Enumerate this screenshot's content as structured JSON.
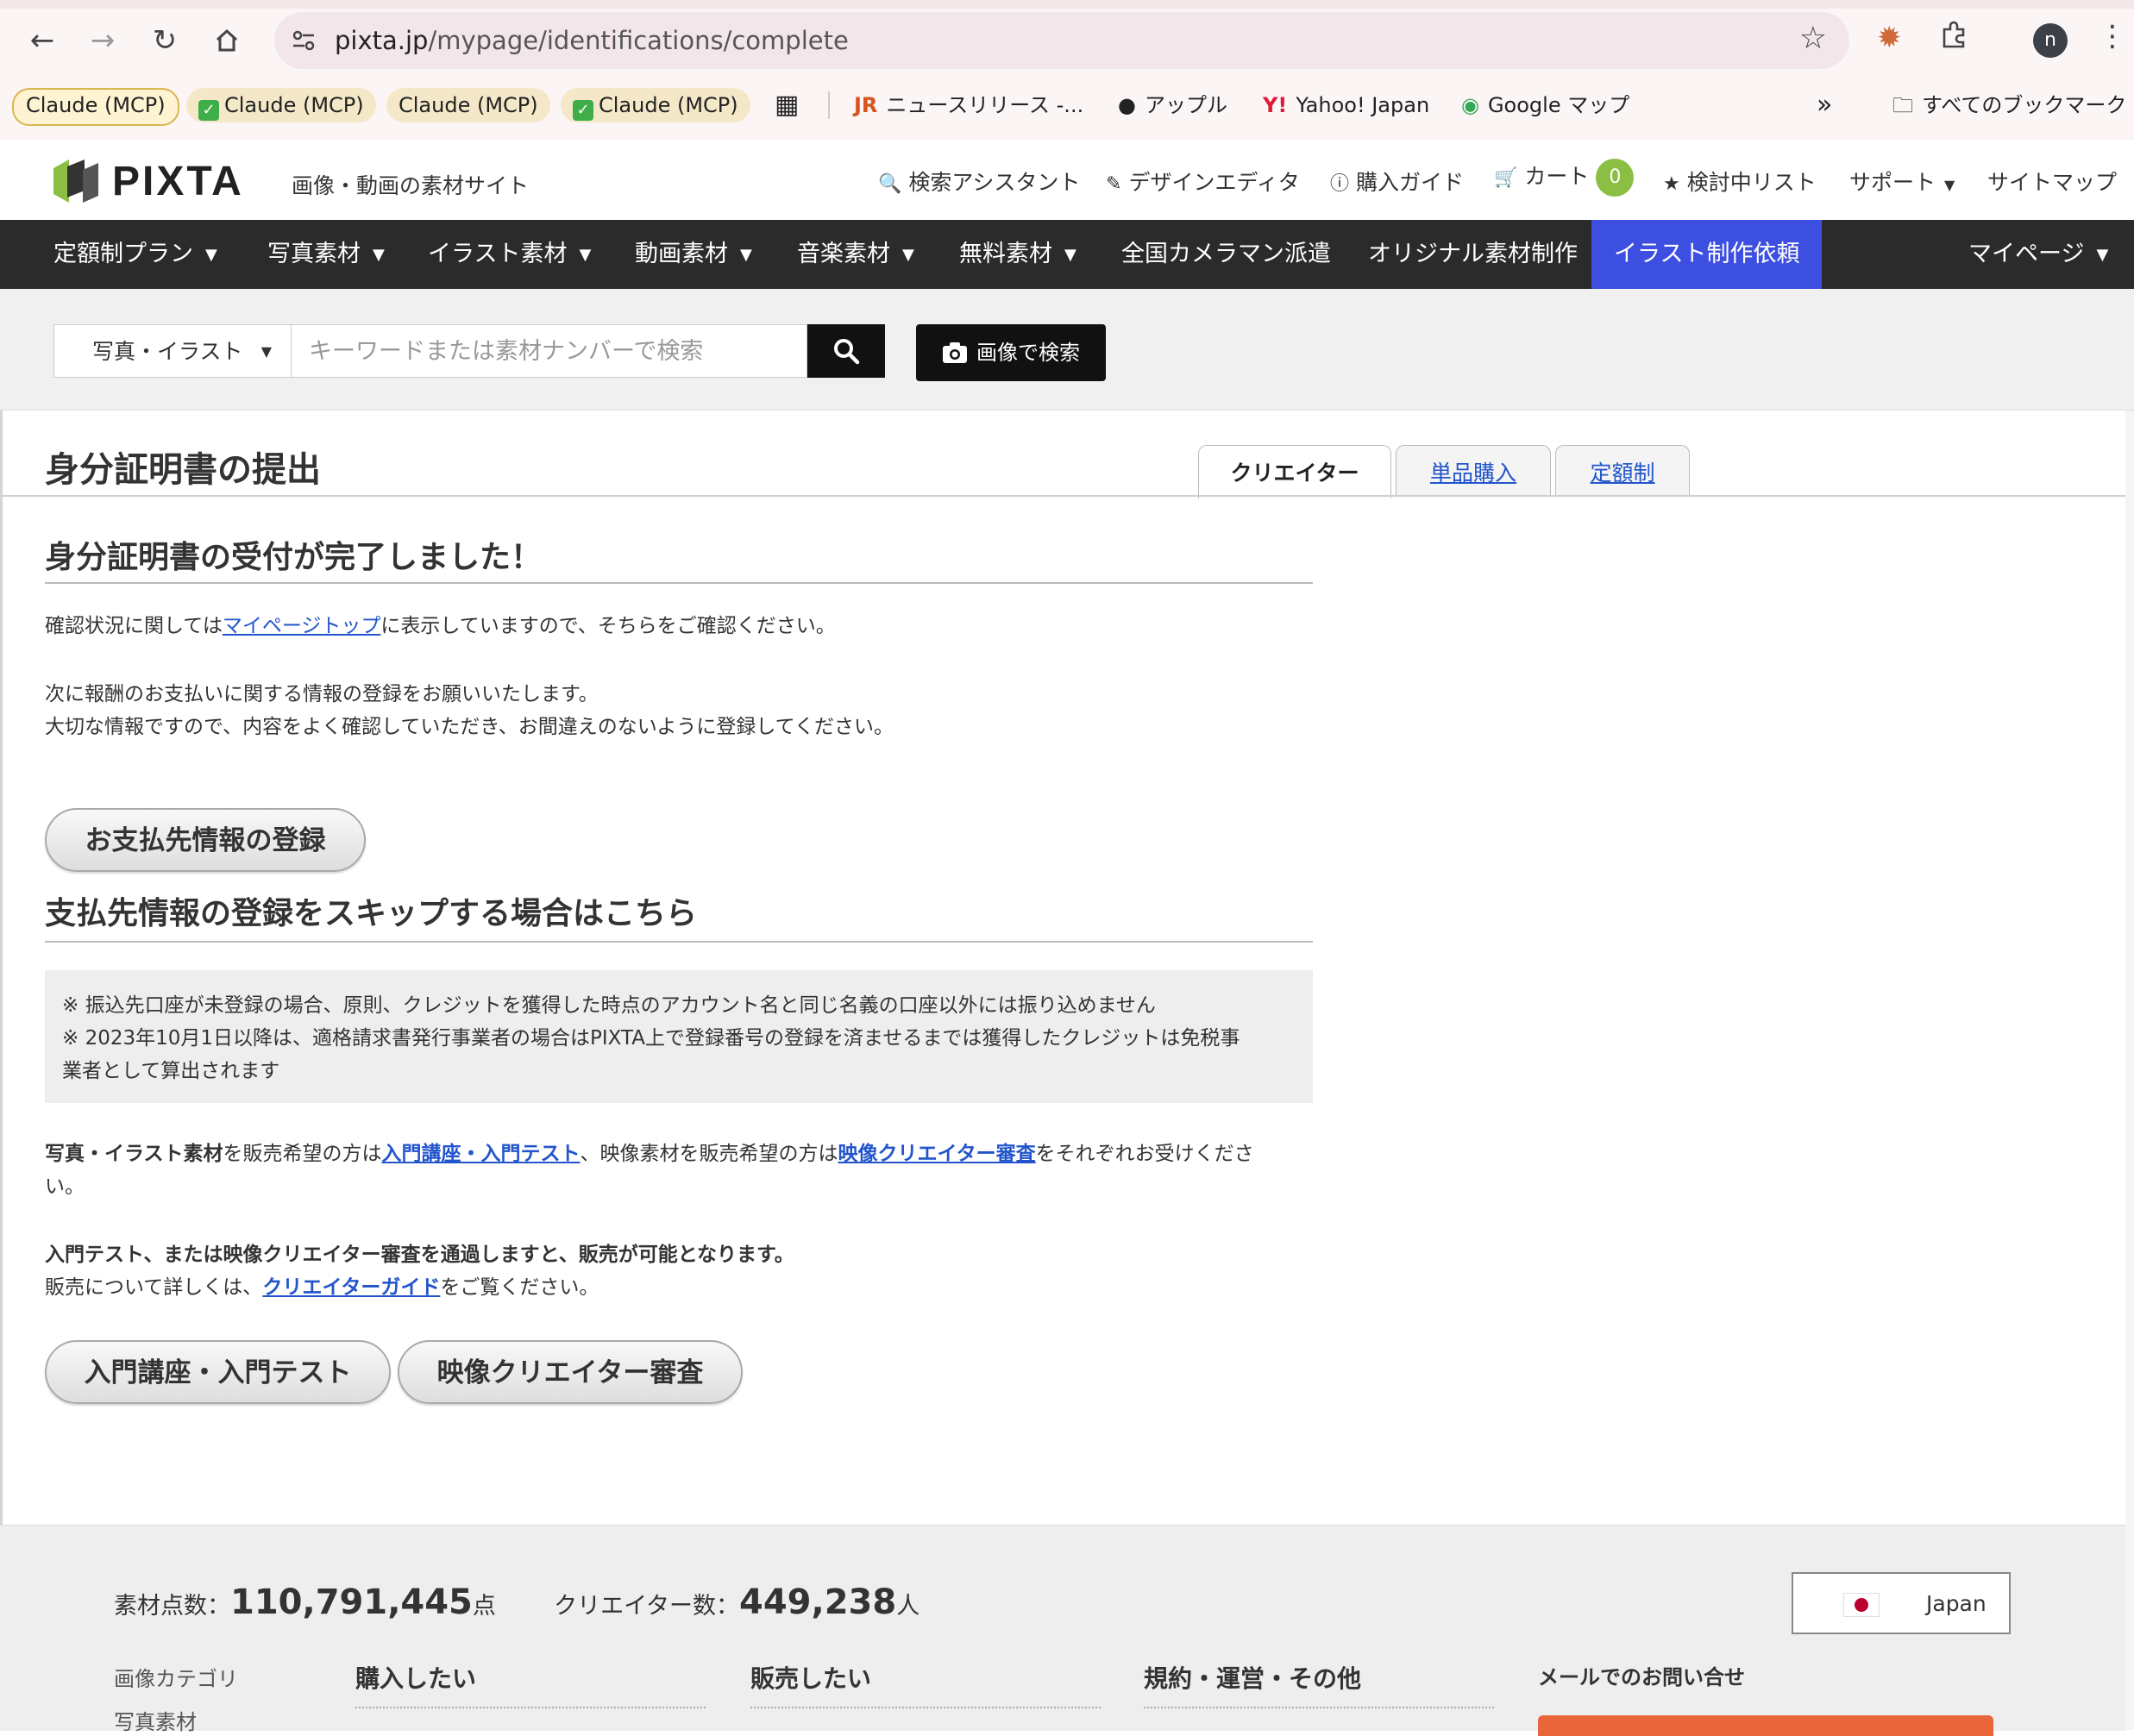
{
  "browser": {
    "url_domain": "pixta.jp",
    "url_path": "/mypage/identifications/complete",
    "profile_initial": "n",
    "bookmarks": [
      {
        "label": "Claude (MCP)",
        "check": false
      },
      {
        "label": "Claude (MCP)",
        "check": true
      },
      {
        "label": "Claude (MCP)",
        "check": false
      },
      {
        "label": "Claude (MCP)",
        "check": true
      },
      {
        "label": "ニュースリリース -..."
      },
      {
        "label": "アップル"
      },
      {
        "label": "Yahoo! Japan"
      },
      {
        "label": "Google マップ"
      },
      {
        "label": "すべてのブックマーク"
      }
    ],
    "overflow_label": "»"
  },
  "header": {
    "logo_text": "PIXTA",
    "tagline": "画像・動画の素材サイト",
    "links": {
      "search_assistant": "検索アシスタント",
      "design_editor": "デザインエディタ",
      "purchase_guide": "購入ガイド",
      "cart": "カート",
      "cart_count": "0",
      "wishlist": "検討中リスト",
      "support": "サポート",
      "sitemap": "サイトマップ"
    }
  },
  "nav": {
    "items": [
      {
        "label": "定額制プラン",
        "dropdown": true
      },
      {
        "label": "写真素材",
        "dropdown": true
      },
      {
        "label": "イラスト素材",
        "dropdown": true
      },
      {
        "label": "動画素材",
        "dropdown": true
      },
      {
        "label": "音楽素材",
        "dropdown": true
      },
      {
        "label": "無料素材",
        "dropdown": true
      },
      {
        "label": "全国カメラマン派遣",
        "dropdown": false
      },
      {
        "label": "オリジナル素材制作",
        "dropdown": false
      },
      {
        "label": "イラスト制作依頼",
        "dropdown": false
      }
    ],
    "mypage": "マイページ",
    "highlight_color": "#3d4fe0"
  },
  "search": {
    "category": "写真・イラスト",
    "placeholder": "キーワードまたは素材ナンバーで検索",
    "image_search": "画像で検索"
  },
  "page": {
    "title": "身分証明書の提出",
    "tabs": [
      "クリエイター",
      "単品購入",
      "定額制"
    ],
    "heading1": "身分証明書の受付が完了しました！",
    "p1_before": "確認状況に関しては",
    "p1_link": "マイページトップ",
    "p1_after": "に表示していますので、そちらをご確認ください。",
    "p2_line1": "次に報酬のお支払いに関する情報の登録をお願いいたします。",
    "p2_line2": "大切な情報ですので、内容をよく確認していただき、お間違えのないように登録してください。",
    "payment_button": "お支払先情報の登録",
    "heading2": "支払先情報の登録をスキップする場合はこちら",
    "notice_line1": "※ 振込先口座が未登録の場合、原則、クレジットを獲得した時点のアカウント名と同じ名義の口座以外には振り込めません",
    "notice_line2": "※ 2023年10月1日以降は、適格請求書発行事業者の場合はPIXTA上で登録番号の登録を済ませるまでは獲得したクレジットは免税事",
    "notice_line3": "業者として算出されます",
    "p3_bold": "写真・イラスト素材",
    "p3_a": "を販売希望の方は",
    "p3_link1": "入門講座・入門テスト",
    "p3_b": "、映像素材を販売希望の方は",
    "p3_link2": "映像クリエイター審査",
    "p3_c": "をそれぞれお受けくださ",
    "p3_wrap": "い。",
    "p4_bold": "入門テスト、または映像クリエイター審査を通過しますと、販売が可能となります。",
    "p5_a": "販売について詳しくは、",
    "p5_link": "クリエイターガイド",
    "p5_b": "をご覧ください。",
    "button_intro": "入門講座・入門テスト",
    "button_video": "映像クリエイター審査"
  },
  "footer": {
    "stat1_label": "素材点数：",
    "stat1_value": "110,791,445",
    "stat1_unit": "点",
    "stat2_label": "クリエイター数：",
    "stat2_value": "449,238",
    "stat2_unit": "人",
    "region": "Japan",
    "category_label": "画像カテゴリ",
    "category_item": "写真素材",
    "col_buy": "購入したい",
    "col_sell": "販売したい",
    "col_terms": "規約・運営・その他",
    "mail_contact": "メールでのお問い合せ"
  }
}
